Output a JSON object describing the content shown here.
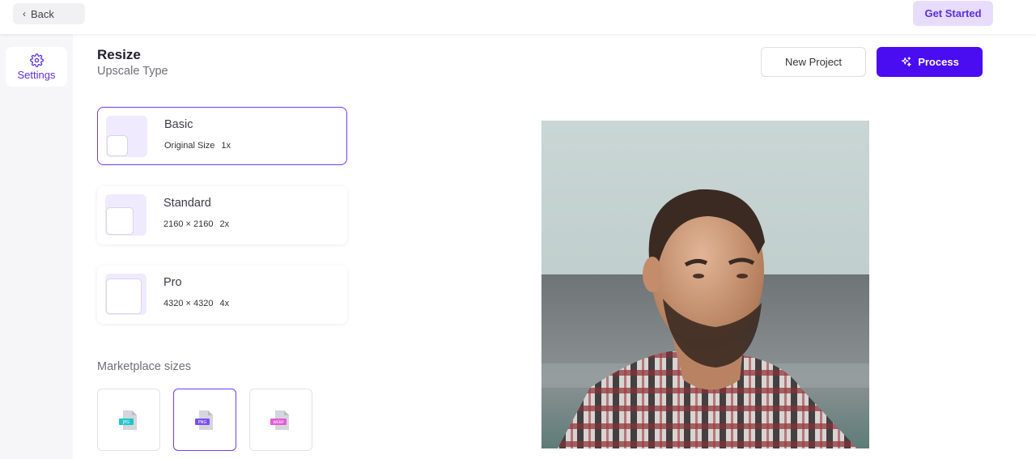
{
  "topbar": {
    "back_label": "Back",
    "get_started_label": "Get Started"
  },
  "sidebar": {
    "items": [
      {
        "label": "Settings",
        "icon": "gear-icon"
      }
    ]
  },
  "header": {
    "title": "Resize",
    "subtitle": "Upscale Type"
  },
  "actions": {
    "new_project_label": "New Project",
    "process_label": "Process"
  },
  "upscale_options": [
    {
      "name": "Basic",
      "size": "Original Size",
      "multiplier": "1x",
      "selected": true
    },
    {
      "name": "Standard",
      "size": "2160 × 2160",
      "multiplier": "2x",
      "selected": false
    },
    {
      "name": "Pro",
      "size": "4320 × 4320",
      "multiplier": "4x",
      "selected": false
    }
  ],
  "marketplace": {
    "label": "Marketplace sizes",
    "formats": [
      {
        "label": "JPG",
        "color": "#1ec8c8",
        "selected": false
      },
      {
        "label": "PNG",
        "color": "#7b4ff2",
        "selected": true
      },
      {
        "label": "WEBP",
        "color": "#e85ad6",
        "selected": false
      }
    ]
  },
  "colors": {
    "accent": "#4a0cf0",
    "accent_light": "#e7dcfb",
    "selected_border": "#6b3ff2"
  }
}
